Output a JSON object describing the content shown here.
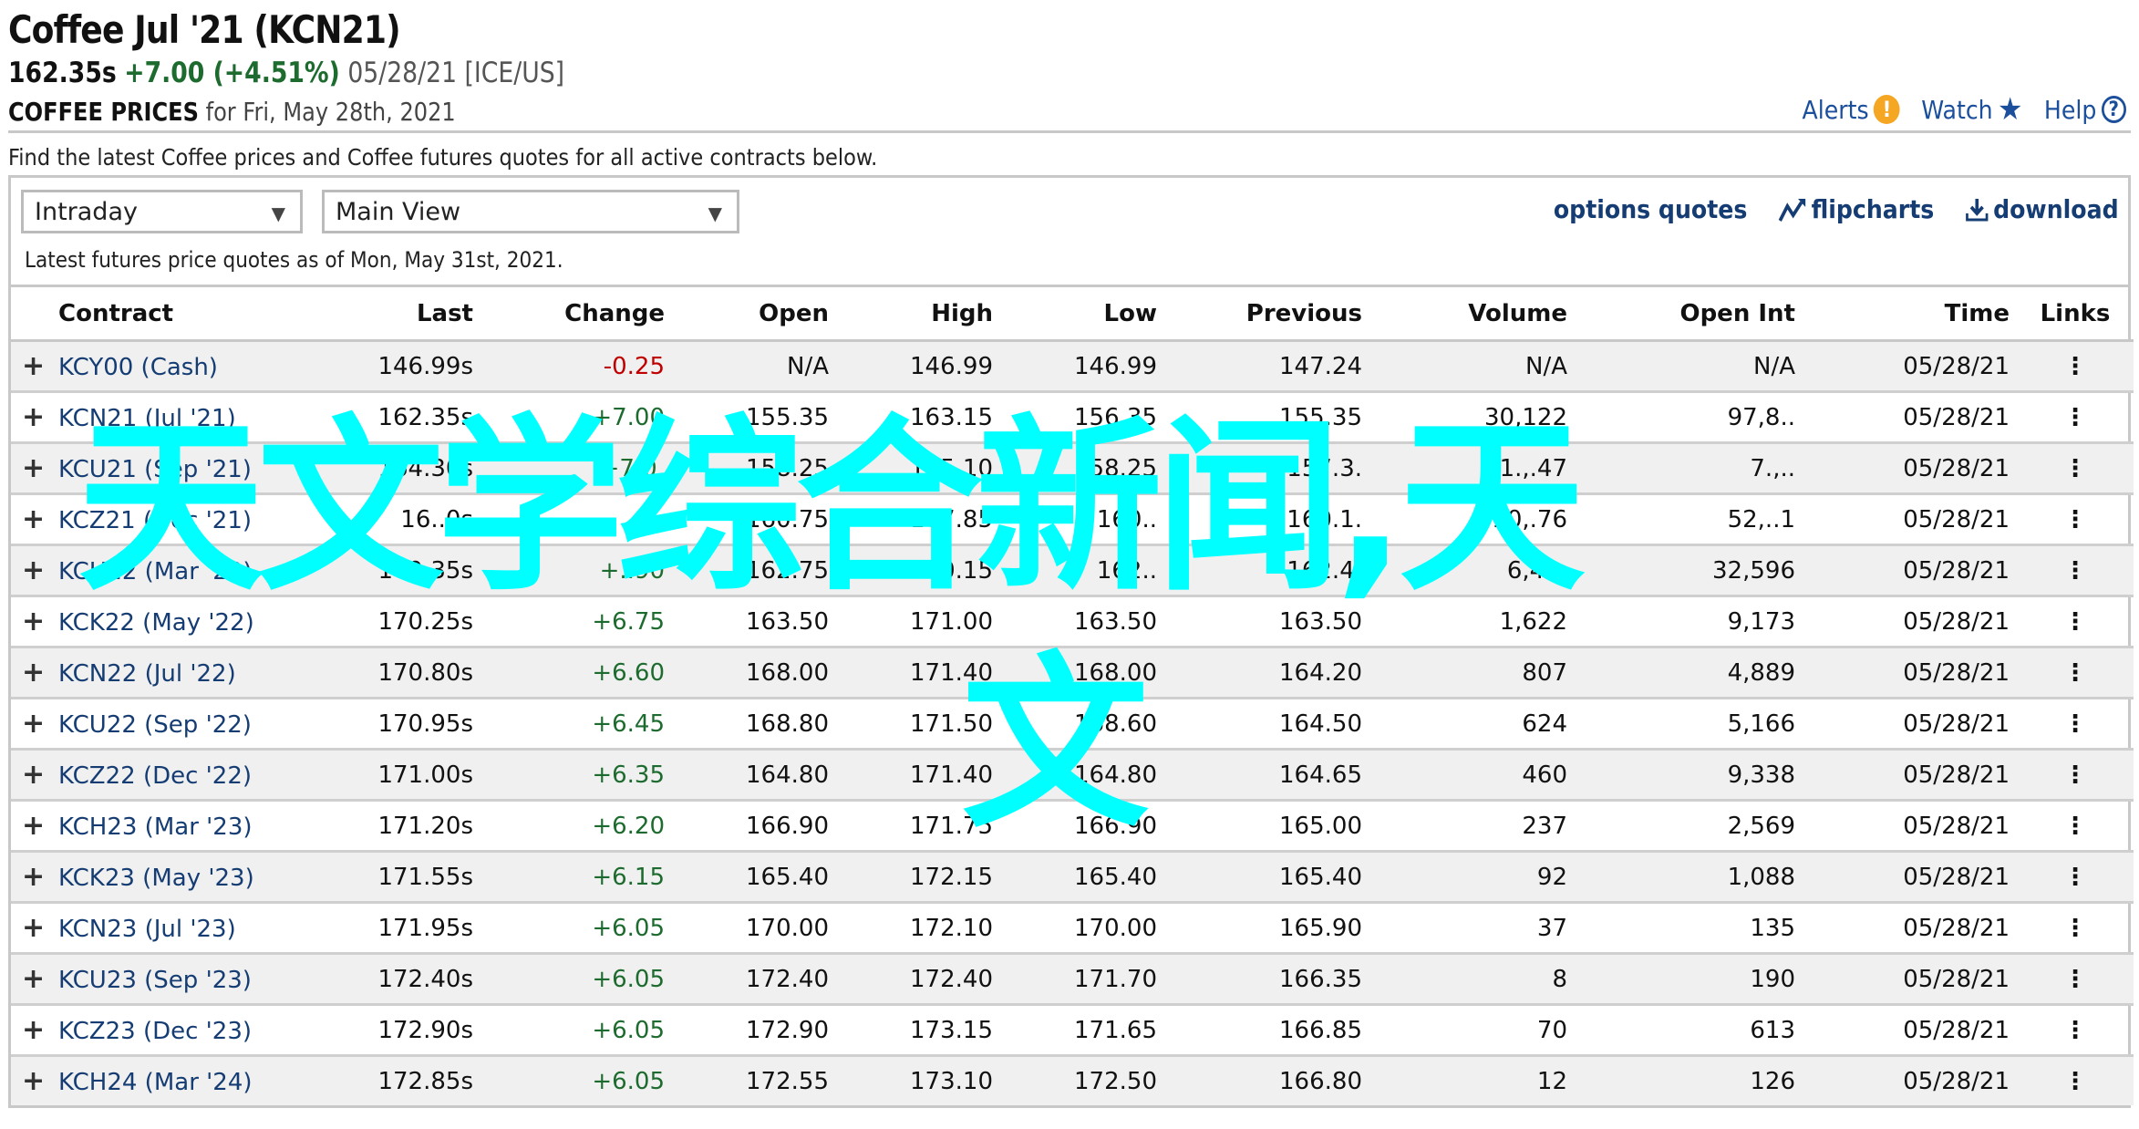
{
  "header": {
    "title": "Coffee Jul '21 (KCN21)",
    "last": "162.35s",
    "change": "+7.00 (+4.51%)",
    "date_exchange": "05/28/21 [ICE/US]",
    "section_label": "COFFEE PRICES",
    "section_date": "for Fri, May 28th, 2021",
    "actions": {
      "alerts": "Alerts",
      "watch": "Watch",
      "help": "Help"
    }
  },
  "intro": "Find the latest Coffee prices and Coffee futures quotes for all active contracts below.",
  "controls": {
    "period_select": "Intraday",
    "view_select": "Main View",
    "links": {
      "options_quotes": "options quotes",
      "flipcharts": "flipcharts",
      "download": "download"
    },
    "as_of": "Latest futures price quotes as of Mon, May 31st, 2021."
  },
  "colors": {
    "link": "#153d73",
    "positive": "#1d6b2e",
    "negative": "#c00000",
    "alert": "#f5a623",
    "watermark": "#00ffff"
  },
  "table": {
    "columns": [
      "Contract",
      "Last",
      "Change",
      "Open",
      "High",
      "Low",
      "Previous",
      "Volume",
      "Open Int",
      "Time",
      "Links"
    ],
    "rows": [
      {
        "contract": "KCY00 (Cash)",
        "last": "146.99s",
        "change": "-0.25",
        "dir": "neg",
        "open": "N/A",
        "high": "146.99",
        "low": "146.99",
        "previous": "147.24",
        "volume": "N/A",
        "open_int": "N/A",
        "time": "05/28/21"
      },
      {
        "contract": "KCN21 (Jul '21)",
        "last": "162.35s",
        "change": "+7.00",
        "dir": "pos",
        "open": "155.35",
        "high": "163.15",
        "low": "156.35",
        "previous": "155.35",
        "volume": "30,122",
        "open_int": "97,8..",
        "time": "05/28/21"
      },
      {
        "contract": "KCU21 (Sep '21)",
        "last": "164.30s",
        "change": "+7.0.",
        "dir": "pos",
        "open": "158.25",
        "high": "165.10",
        "low": "158.25",
        "previous": "157.3.",
        "volume": "1.,.47",
        "open_int": "7.,..",
        "time": "05/28/21"
      },
      {
        "contract": "KCZ21 (Dec '21)",
        "last": "16..0s",
        "change": "+..",
        "dir": "pos",
        "open": "160.75",
        "high": "167.85",
        "low": "160..",
        "previous": "160.1.",
        "volume": "10,.76",
        "open_int": "52,..1",
        "time": "05/28/21"
      },
      {
        "contract": "KCH22 (Mar '22)",
        "last": "169.35s",
        "change": "+..90",
        "dir": "pos",
        "open": "162.75",
        "high": "170.15",
        "low": "162..",
        "previous": "162.4.",
        "volume": "6,41.",
        "open_int": "32,596",
        "time": "05/28/21"
      },
      {
        "contract": "KCK22 (May '22)",
        "last": "170.25s",
        "change": "+6.75",
        "dir": "pos",
        "open": "163.50",
        "high": "171.00",
        "low": "163.50",
        "previous": "163.50",
        "volume": "1,622",
        "open_int": "9,173",
        "time": "05/28/21"
      },
      {
        "contract": "KCN22 (Jul '22)",
        "last": "170.80s",
        "change": "+6.60",
        "dir": "pos",
        "open": "168.00",
        "high": "171.40",
        "low": "168.00",
        "previous": "164.20",
        "volume": "807",
        "open_int": "4,889",
        "time": "05/28/21"
      },
      {
        "contract": "KCU22 (Sep '22)",
        "last": "170.95s",
        "change": "+6.45",
        "dir": "pos",
        "open": "168.80",
        "high": "171.50",
        "low": "168.60",
        "previous": "164.50",
        "volume": "624",
        "open_int": "5,166",
        "time": "05/28/21"
      },
      {
        "contract": "KCZ22 (Dec '22)",
        "last": "171.00s",
        "change": "+6.35",
        "dir": "pos",
        "open": "164.80",
        "high": "171.40",
        "low": "164.80",
        "previous": "164.65",
        "volume": "460",
        "open_int": "9,338",
        "time": "05/28/21"
      },
      {
        "contract": "KCH23 (Mar '23)",
        "last": "171.20s",
        "change": "+6.20",
        "dir": "pos",
        "open": "166.90",
        "high": "171.75",
        "low": "166.90",
        "previous": "165.00",
        "volume": "237",
        "open_int": "2,569",
        "time": "05/28/21"
      },
      {
        "contract": "KCK23 (May '23)",
        "last": "171.55s",
        "change": "+6.15",
        "dir": "pos",
        "open": "165.40",
        "high": "172.15",
        "low": "165.40",
        "previous": "165.40",
        "volume": "92",
        "open_int": "1,088",
        "time": "05/28/21"
      },
      {
        "contract": "KCN23 (Jul '23)",
        "last": "171.95s",
        "change": "+6.05",
        "dir": "pos",
        "open": "170.00",
        "high": "172.10",
        "low": "170.00",
        "previous": "165.90",
        "volume": "37",
        "open_int": "135",
        "time": "05/28/21"
      },
      {
        "contract": "KCU23 (Sep '23)",
        "last": "172.40s",
        "change": "+6.05",
        "dir": "pos",
        "open": "172.40",
        "high": "172.40",
        "low": "171.70",
        "previous": "166.35",
        "volume": "8",
        "open_int": "190",
        "time": "05/28/21"
      },
      {
        "contract": "KCZ23 (Dec '23)",
        "last": "172.90s",
        "change": "+6.05",
        "dir": "pos",
        "open": "172.90",
        "high": "173.15",
        "low": "171.65",
        "previous": "166.85",
        "volume": "70",
        "open_int": "613",
        "time": "05/28/21"
      },
      {
        "contract": "KCH24 (Mar '24)",
        "last": "172.85s",
        "change": "+6.05",
        "dir": "pos",
        "open": "172.55",
        "high": "173.10",
        "low": "172.50",
        "previous": "166.80",
        "volume": "12",
        "open_int": "126",
        "time": "05/28/21"
      }
    ]
  },
  "watermark": {
    "line1": "天文学综合新闻,天",
    "line2": "文"
  }
}
